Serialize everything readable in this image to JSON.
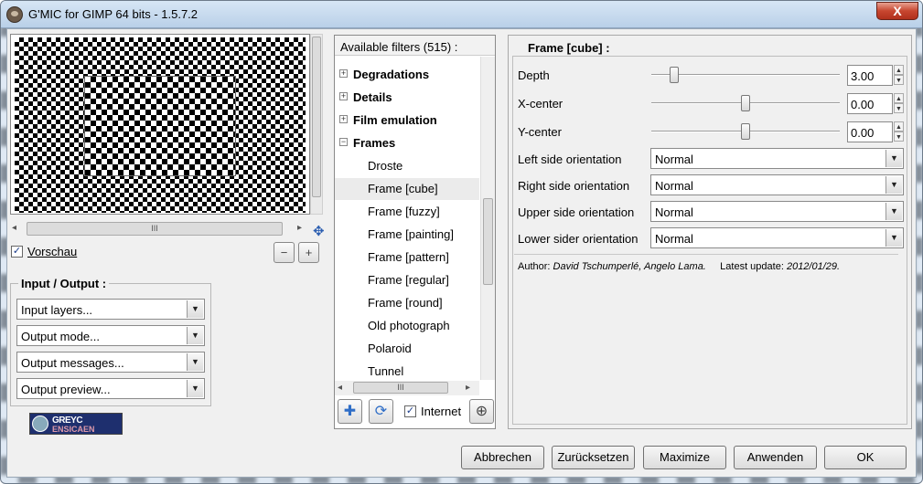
{
  "window": {
    "title": "G'MIC for GIMP 64 bits - 1.5.7.2",
    "close_glyph": "X"
  },
  "preview": {
    "checkbox_label": "Vorschau",
    "checkbox_checked": true,
    "checkmark": "✓",
    "scroll_grip": "III",
    "left_arrow": "◂",
    "right_arrow": "▸",
    "move_glyph": "✥",
    "zoom_out_glyph": "−",
    "zoom_in_glyph": "+"
  },
  "input_output": {
    "title": "Input / Output :",
    "dropdown_arrow": "▼",
    "combos": [
      {
        "value": "Input layers..."
      },
      {
        "value": "Output mode..."
      },
      {
        "value": "Output messages..."
      },
      {
        "value": "Output preview..."
      }
    ]
  },
  "logo": {
    "line1": "GREYC",
    "line2": "ENSICAEN"
  },
  "filters": {
    "header": "Available filters (515) :",
    "items": [
      {
        "label": "Degradations",
        "type": "category",
        "expander": "+"
      },
      {
        "label": "Details",
        "type": "category",
        "expander": "+"
      },
      {
        "label": "Film emulation",
        "type": "category",
        "expander": "+"
      },
      {
        "label": "Frames",
        "type": "category",
        "expander": "−"
      },
      {
        "label": "Droste",
        "type": "filter"
      },
      {
        "label": "Frame [cube]",
        "type": "filter",
        "selected": true
      },
      {
        "label": "Frame [fuzzy]",
        "type": "filter"
      },
      {
        "label": "Frame [painting]",
        "type": "filter"
      },
      {
        "label": "Frame [pattern]",
        "type": "filter"
      },
      {
        "label": "Frame [regular]",
        "type": "filter"
      },
      {
        "label": "Frame [round]",
        "type": "filter"
      },
      {
        "label": "Old photograph",
        "type": "filter"
      },
      {
        "label": "Polaroid",
        "type": "filter"
      },
      {
        "label": "Tunnel",
        "type": "filter"
      }
    ],
    "scroll_grip": "III",
    "add_glyph": "✚",
    "refresh_glyph": "⟳",
    "internet_label": "Internet",
    "internet_checked": true,
    "zoom_glyph": "⊕"
  },
  "params": {
    "title": "Frame [cube] :",
    "sliders": [
      {
        "label": "Depth",
        "value": "3.00",
        "level": 0.11
      },
      {
        "label": "X-center",
        "value": "0.00",
        "level": 0.5
      },
      {
        "label": "Y-center",
        "value": "0.00",
        "level": 0.5
      }
    ],
    "spin_up": "▲",
    "spin_down": "▼",
    "dropdowns": [
      {
        "label": "Left side orientation",
        "value": "Normal"
      },
      {
        "label": "Right side orientation",
        "value": "Normal"
      },
      {
        "label": "Upper side orientation",
        "value": "Normal"
      },
      {
        "label": "Lower sider orientation",
        "value": "Normal"
      }
    ],
    "author_label": "Author:",
    "author_value": "David Tschumperlé, Angelo Lama.",
    "update_label": "Latest update:",
    "update_value": "2012/01/29."
  },
  "buttons": {
    "cancel": "Abbrechen",
    "reset": "Zurücksetzen",
    "maximize": "Maximize",
    "apply": "Anwenden",
    "ok": "OK"
  }
}
